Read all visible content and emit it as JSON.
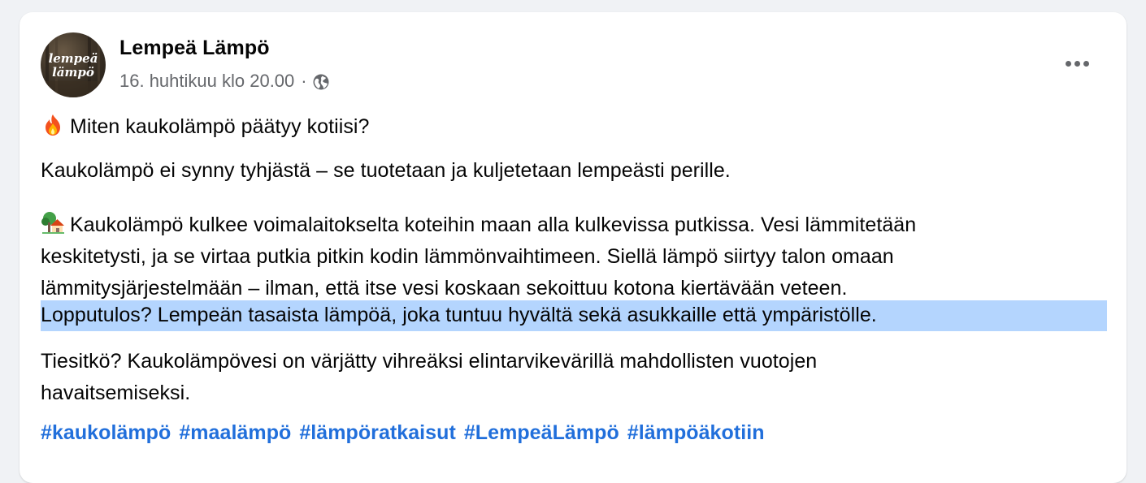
{
  "post": {
    "author": "Lempeä Lämpö",
    "avatar_text_line1": "lempeä",
    "avatar_text_line2": "lämpö",
    "timestamp": "16. huhtikuu klo 20.00",
    "separator": "·",
    "audience_icon": "globe-icon",
    "menu_icon": "more-options-icon",
    "emoji_fire": "fire-icon",
    "emoji_house": "house-with-garden-icon",
    "p1_text": "Miten kaukolämpö päätyy kotiisi?",
    "p2_text": "Kaukolämpö ei synny tyhjästä – se tuotetaan ja kuljetetaan lempeästi perille.",
    "p3_line1": "Kaukolämpö kulkee voimalaitokselta koteihin maan alla kulkevissa putkissa. Vesi lämmitetään",
    "p3_line2": "keskitetysti, ja se virtaa putkia pitkin kodin lämmönvaihtimeen. Siellä lämpö siirtyy talon omaan",
    "p3_line3": "lämmitysjärjestelmään – ilman, että itse vesi koskaan sekoittuu kotona kiertävään veteen.",
    "p4_text": "Lopputulos? Lempeän tasaista lämpöä, joka tuntuu hyvältä sekä asukkaille että ympäristölle.",
    "p5_line1": "Tiesitkö? Kaukolämpövesi on värjätty vihreäksi elintarvikevärillä mahdollisten vuotojen",
    "p5_line2": "havaitsemiseksi.",
    "hashtags": [
      "#kaukolämpö",
      "#maalämpö",
      "#lämpöratkaisut",
      "#LempeäLämpö",
      "#lämpöäkotiin"
    ],
    "colors": {
      "hashtag": "#216fdb",
      "selection_highlight": "#b4d5fe",
      "meta_text": "#65676b"
    }
  }
}
